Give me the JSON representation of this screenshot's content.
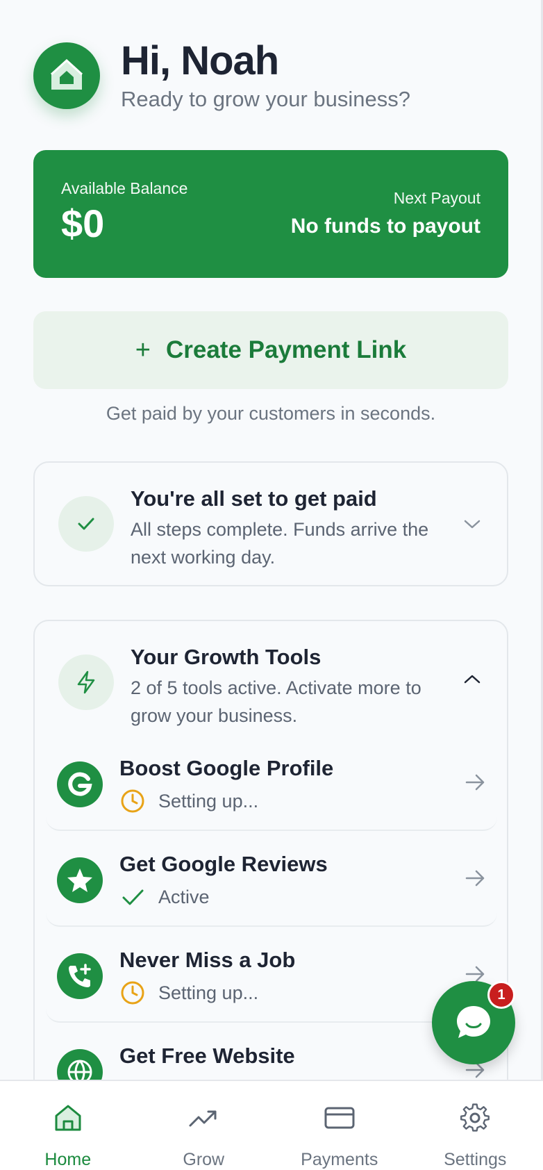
{
  "header": {
    "greeting": "Hi, Noah",
    "subtitle": "Ready to grow your business?",
    "logo_icon": "house-icon"
  },
  "balance": {
    "label": "Available Balance",
    "value": "$0",
    "payout_label": "Next Payout",
    "payout_value": "No funds to payout"
  },
  "create_link": {
    "icon": "plus-icon",
    "label": "Create Payment Link",
    "caption": "Get paid by your customers in seconds."
  },
  "all_set": {
    "title": "You're all set to get paid",
    "description": "All steps complete. Funds arrive the next working day."
  },
  "growth": {
    "title": "Your Growth Tools",
    "description": "2 of 5 tools active. Activate more to grow your business.",
    "tools": [
      {
        "name": "Boost Google Profile",
        "status": "Setting up...",
        "icon": "google-g-icon",
        "status_icon": "clock-icon"
      },
      {
        "name": "Get Google Reviews",
        "status": "Active",
        "icon": "star-icon",
        "status_icon": "check-icon"
      },
      {
        "name": "Never Miss a Job",
        "status": "Setting up...",
        "icon": "phone-plus-icon",
        "status_icon": "clock-icon"
      },
      {
        "name": "Get Free Website",
        "status": "",
        "icon": "globe-icon",
        "status_icon": ""
      }
    ]
  },
  "chat": {
    "badge": "1"
  },
  "nav": {
    "items": [
      {
        "label": "Home",
        "icon": "home-icon",
        "active": true
      },
      {
        "label": "Grow",
        "icon": "trending-up-icon",
        "active": false
      },
      {
        "label": "Payments",
        "icon": "credit-card-icon",
        "active": false
      },
      {
        "label": "Settings",
        "icon": "gear-icon",
        "active": false
      }
    ]
  },
  "colors": {
    "brand": "#1f8f43",
    "brand_dark_text": "#1b7b3a",
    "pending": "#e8a317",
    "badge": "#c81e1e"
  }
}
